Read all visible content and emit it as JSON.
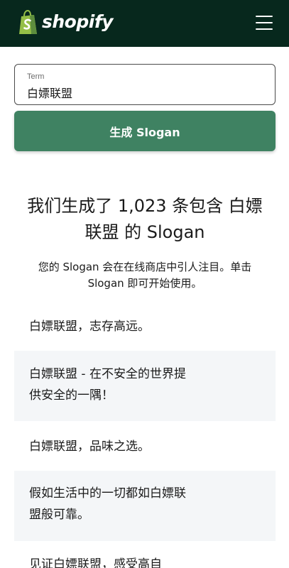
{
  "header": {
    "brand": "shopify",
    "brand_color": "#07281d",
    "logo_icon": "shopify-bag-icon",
    "menu_icon": "hamburger-menu-icon"
  },
  "form": {
    "term_label": "Term",
    "term_value": "白嫖联盟",
    "generate_label": "生成 Slogan",
    "button_color": "#3f8262"
  },
  "results": {
    "headline_line1": "我们生成了 1,023 条包含 白嫖",
    "headline_line2": "联盟 的 Slogan",
    "subtext_line1": "您的 Slogan 会在在线商店中引人注目。单击",
    "subtext_line2": "Slogan 即可开始使用。",
    "slogans": [
      {
        "line1": "白嫖联盟，志存高远。",
        "line2": ""
      },
      {
        "line1": "白嫖联盟 - 在不安全的世界提",
        "line2": "供安全的一隅！"
      },
      {
        "line1": "白嫖联盟，品味之选。",
        "line2": ""
      },
      {
        "line1": "假如生活中的一切都如白嫖联",
        "line2": "盟般可靠。"
      },
      {
        "line1": "见证白嫖联盟，感受高自",
        "line2": ""
      }
    ]
  }
}
